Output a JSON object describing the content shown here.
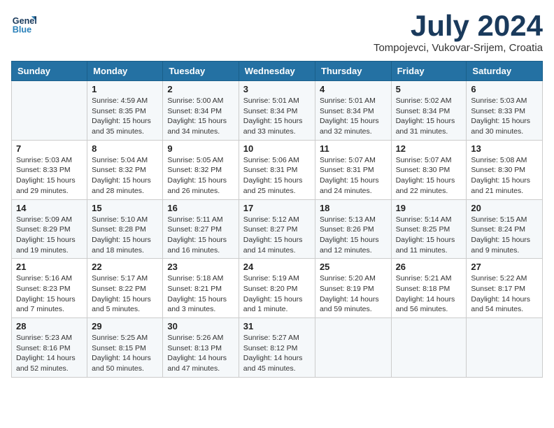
{
  "header": {
    "logo_line1": "General",
    "logo_line2": "Blue",
    "month": "July 2024",
    "location": "Tompojevci, Vukovar-Srijem, Croatia"
  },
  "weekdays": [
    "Sunday",
    "Monday",
    "Tuesday",
    "Wednesday",
    "Thursday",
    "Friday",
    "Saturday"
  ],
  "weeks": [
    [
      {
        "day": "",
        "info": ""
      },
      {
        "day": "1",
        "info": "Sunrise: 4:59 AM\nSunset: 8:35 PM\nDaylight: 15 hours\nand 35 minutes."
      },
      {
        "day": "2",
        "info": "Sunrise: 5:00 AM\nSunset: 8:34 PM\nDaylight: 15 hours\nand 34 minutes."
      },
      {
        "day": "3",
        "info": "Sunrise: 5:01 AM\nSunset: 8:34 PM\nDaylight: 15 hours\nand 33 minutes."
      },
      {
        "day": "4",
        "info": "Sunrise: 5:01 AM\nSunset: 8:34 PM\nDaylight: 15 hours\nand 32 minutes."
      },
      {
        "day": "5",
        "info": "Sunrise: 5:02 AM\nSunset: 8:34 PM\nDaylight: 15 hours\nand 31 minutes."
      },
      {
        "day": "6",
        "info": "Sunrise: 5:03 AM\nSunset: 8:33 PM\nDaylight: 15 hours\nand 30 minutes."
      }
    ],
    [
      {
        "day": "7",
        "info": "Sunrise: 5:03 AM\nSunset: 8:33 PM\nDaylight: 15 hours\nand 29 minutes."
      },
      {
        "day": "8",
        "info": "Sunrise: 5:04 AM\nSunset: 8:32 PM\nDaylight: 15 hours\nand 28 minutes."
      },
      {
        "day": "9",
        "info": "Sunrise: 5:05 AM\nSunset: 8:32 PM\nDaylight: 15 hours\nand 26 minutes."
      },
      {
        "day": "10",
        "info": "Sunrise: 5:06 AM\nSunset: 8:31 PM\nDaylight: 15 hours\nand 25 minutes."
      },
      {
        "day": "11",
        "info": "Sunrise: 5:07 AM\nSunset: 8:31 PM\nDaylight: 15 hours\nand 24 minutes."
      },
      {
        "day": "12",
        "info": "Sunrise: 5:07 AM\nSunset: 8:30 PM\nDaylight: 15 hours\nand 22 minutes."
      },
      {
        "day": "13",
        "info": "Sunrise: 5:08 AM\nSunset: 8:30 PM\nDaylight: 15 hours\nand 21 minutes."
      }
    ],
    [
      {
        "day": "14",
        "info": "Sunrise: 5:09 AM\nSunset: 8:29 PM\nDaylight: 15 hours\nand 19 minutes."
      },
      {
        "day": "15",
        "info": "Sunrise: 5:10 AM\nSunset: 8:28 PM\nDaylight: 15 hours\nand 18 minutes."
      },
      {
        "day": "16",
        "info": "Sunrise: 5:11 AM\nSunset: 8:27 PM\nDaylight: 15 hours\nand 16 minutes."
      },
      {
        "day": "17",
        "info": "Sunrise: 5:12 AM\nSunset: 8:27 PM\nDaylight: 15 hours\nand 14 minutes."
      },
      {
        "day": "18",
        "info": "Sunrise: 5:13 AM\nSunset: 8:26 PM\nDaylight: 15 hours\nand 12 minutes."
      },
      {
        "day": "19",
        "info": "Sunrise: 5:14 AM\nSunset: 8:25 PM\nDaylight: 15 hours\nand 11 minutes."
      },
      {
        "day": "20",
        "info": "Sunrise: 5:15 AM\nSunset: 8:24 PM\nDaylight: 15 hours\nand 9 minutes."
      }
    ],
    [
      {
        "day": "21",
        "info": "Sunrise: 5:16 AM\nSunset: 8:23 PM\nDaylight: 15 hours\nand 7 minutes."
      },
      {
        "day": "22",
        "info": "Sunrise: 5:17 AM\nSunset: 8:22 PM\nDaylight: 15 hours\nand 5 minutes."
      },
      {
        "day": "23",
        "info": "Sunrise: 5:18 AM\nSunset: 8:21 PM\nDaylight: 15 hours\nand 3 minutes."
      },
      {
        "day": "24",
        "info": "Sunrise: 5:19 AM\nSunset: 8:20 PM\nDaylight: 15 hours\nand 1 minute."
      },
      {
        "day": "25",
        "info": "Sunrise: 5:20 AM\nSunset: 8:19 PM\nDaylight: 14 hours\nand 59 minutes."
      },
      {
        "day": "26",
        "info": "Sunrise: 5:21 AM\nSunset: 8:18 PM\nDaylight: 14 hours\nand 56 minutes."
      },
      {
        "day": "27",
        "info": "Sunrise: 5:22 AM\nSunset: 8:17 PM\nDaylight: 14 hours\nand 54 minutes."
      }
    ],
    [
      {
        "day": "28",
        "info": "Sunrise: 5:23 AM\nSunset: 8:16 PM\nDaylight: 14 hours\nand 52 minutes."
      },
      {
        "day": "29",
        "info": "Sunrise: 5:25 AM\nSunset: 8:15 PM\nDaylight: 14 hours\nand 50 minutes."
      },
      {
        "day": "30",
        "info": "Sunrise: 5:26 AM\nSunset: 8:13 PM\nDaylight: 14 hours\nand 47 minutes."
      },
      {
        "day": "31",
        "info": "Sunrise: 5:27 AM\nSunset: 8:12 PM\nDaylight: 14 hours\nand 45 minutes."
      },
      {
        "day": "",
        "info": ""
      },
      {
        "day": "",
        "info": ""
      },
      {
        "day": "",
        "info": ""
      }
    ]
  ]
}
